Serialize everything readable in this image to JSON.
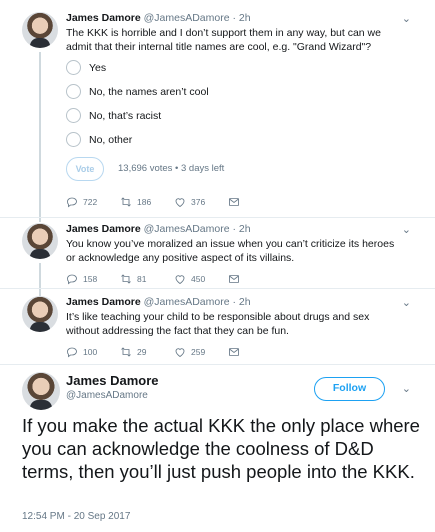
{
  "tweets": [
    {
      "name": "James Damore",
      "handle": "@JamesADamore",
      "time": "2h",
      "text": "The KKK is horrible and I don’t support them in any way, but can we admit that their internal title names are cool, e.g. \"Grand Wizard\"?",
      "poll": {
        "options": [
          "Yes",
          "No, the names aren’t cool",
          "No, that’s racist",
          "No, other"
        ],
        "vote_label": "Vote",
        "meta": "13,696 votes • 3 days left"
      },
      "replies": "722",
      "retweets": "186",
      "likes": "376"
    },
    {
      "name": "James Damore",
      "handle": "@JamesADamore",
      "time": "2h",
      "text": "You know you’ve moralized an issue when you can’t criticize its heroes or acknowledge any positive aspect of its villains.",
      "replies": "158",
      "retweets": "81",
      "likes": "450"
    },
    {
      "name": "James Damore",
      "handle": "@JamesADamore",
      "time": "2h",
      "text": "It’s like teaching your child to be responsible about drugs and sex without addressing the fact that they can be fun.",
      "replies": "100",
      "retweets": "29",
      "likes": "259"
    }
  ],
  "main_tweet": {
    "name": "James Damore",
    "handle": "@JamesADamore",
    "follow_label": "Follow",
    "text": "If you make the actual KKK the only place where you can acknowledge the coolness of D&D terms, then you’ll just push people into the KKK.",
    "timestamp": "12:54 PM - 20 Sep 2017"
  },
  "colors": {
    "accent": "#1da1f2",
    "secondary_text": "#657786",
    "thread_line": "#cfd9de"
  },
  "icons": [
    "reply-icon",
    "retweet-icon",
    "like-icon",
    "message-icon",
    "chevron-down-icon"
  ]
}
